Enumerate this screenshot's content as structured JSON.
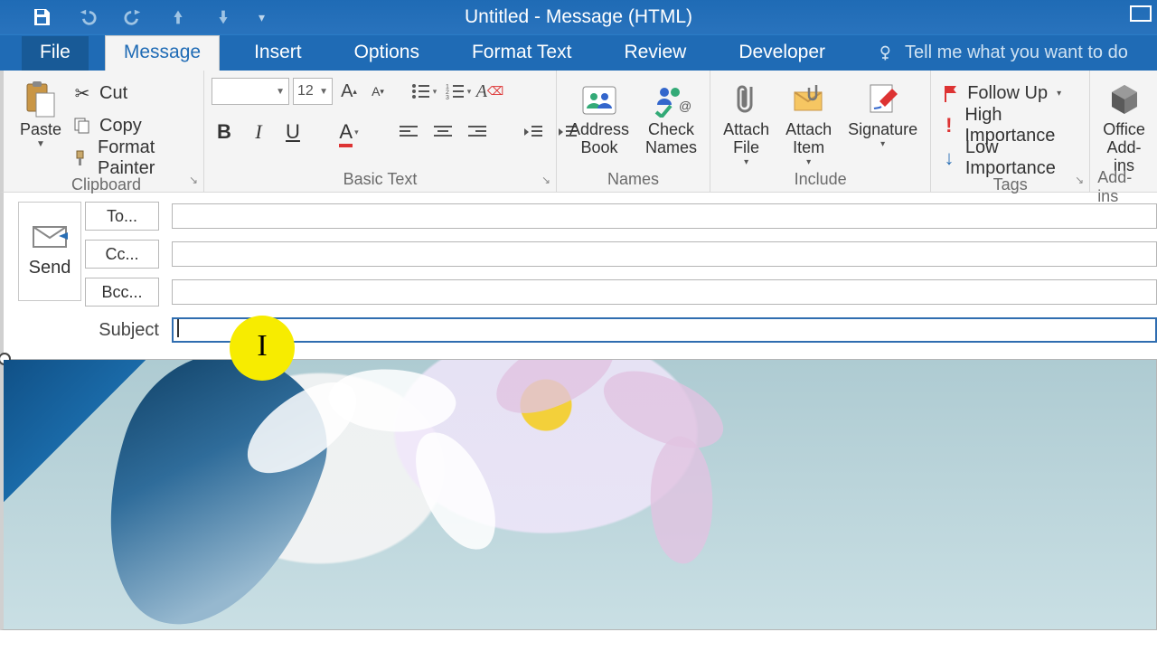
{
  "titlebar": {
    "title": "Untitled - Message (HTML)"
  },
  "tabs": {
    "file": "File",
    "active": "Message",
    "items": [
      "Insert",
      "Options",
      "Format Text",
      "Review",
      "Developer"
    ],
    "tellme": "Tell me what you want to do"
  },
  "clipboard": {
    "paste": "Paste",
    "cut": "Cut",
    "copy": "Copy",
    "format_painter": "Format Painter",
    "group": "Clipboard"
  },
  "font": {
    "name": "",
    "size": "12",
    "group": "Basic Text"
  },
  "names": {
    "address_book": "Address\nBook",
    "check_names": "Check\nNames",
    "group": "Names"
  },
  "include": {
    "attach_file": "Attach\nFile",
    "attach_item": "Attach\nItem",
    "signature": "Signature",
    "group": "Include"
  },
  "tags": {
    "follow_up": "Follow Up",
    "high": "High Importance",
    "low": "Low Importance",
    "group": "Tags"
  },
  "addins": {
    "office_addins": "Office\nAdd-ins",
    "group": "Add-ins"
  },
  "compose": {
    "send": "Send",
    "to": "To...",
    "cc": "Cc...",
    "bcc": "Bcc...",
    "subject": "Subject",
    "to_value": "",
    "cc_value": "",
    "bcc_value": "",
    "subject_value": ""
  }
}
